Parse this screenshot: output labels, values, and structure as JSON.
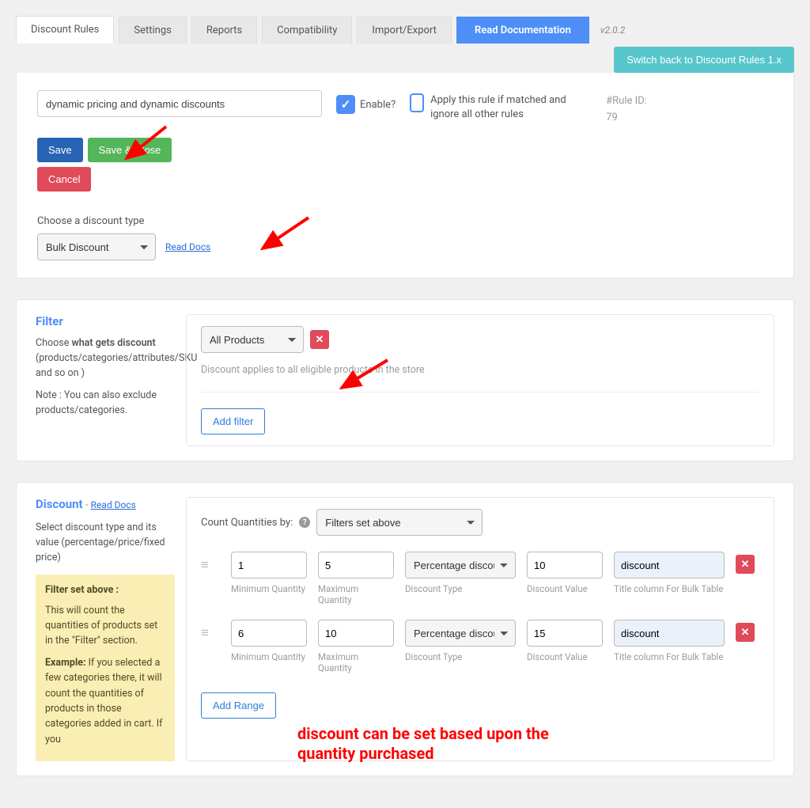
{
  "tabs": {
    "rules": "Discount Rules",
    "settings": "Settings",
    "reports": "Reports",
    "compat": "Compatibility",
    "importexport": "Import/Export",
    "docs": "Read Documentation"
  },
  "version": "v2.0.2",
  "switch_back": "Switch back to Discount Rules 1.x",
  "rule_name": {
    "value": "dynamic pricing and dynamic discounts"
  },
  "enable": {
    "label": "Enable?",
    "checked": true
  },
  "ignore_others": {
    "label": "Apply this rule if matched and ignore all other rules",
    "checked": false
  },
  "rule_id": {
    "label": "#Rule ID:",
    "value": "79"
  },
  "buttons": {
    "save": "Save",
    "save_close": "Save & Close",
    "cancel": "Cancel"
  },
  "discount_type": {
    "label": "Choose a discount type",
    "value": "Bulk Discount",
    "read_docs": "Read Docs"
  },
  "filter": {
    "title": "Filter",
    "help_lead": "Choose ",
    "help_bold": "what gets discount",
    "help_rest": " (products/categories/attributes/SKU and so on )",
    "note": "Note : You can also exclude products/categories.",
    "select_value": "All Products",
    "applies_text": "Discount applies to all eligible products in the store",
    "add_filter": "Add filter"
  },
  "discount": {
    "title": "Discount",
    "read_docs": "Read Docs",
    "help": "Select discount type and its value (percentage/price/fixed price)",
    "helpbox": {
      "h": "Filter set above :",
      "p1": "This will count the quantities of products set in the \"Filter\" section.",
      "p2_lead": "Example:",
      "p2_rest": " If you selected a few categories there, it will count the quantities of products in those categories added in cart. If you"
    },
    "count_label": "Count Quantities by:",
    "count_select": "Filters set above",
    "type_option": "Percentage discount",
    "range_labels": {
      "min": "Minimum Quantity",
      "max": "Maximum Quantity",
      "type": "Discount Type",
      "value": "Discount Value",
      "title": "Title column For Bulk Table"
    },
    "ranges": [
      {
        "min": "1",
        "max": "5",
        "value": "10",
        "title": "discount"
      },
      {
        "min": "6",
        "max": "10",
        "value": "15",
        "title": "discount"
      }
    ],
    "add_range": "Add Range"
  },
  "annotation": {
    "text": "discount can be set based upon the quantity purchased"
  }
}
